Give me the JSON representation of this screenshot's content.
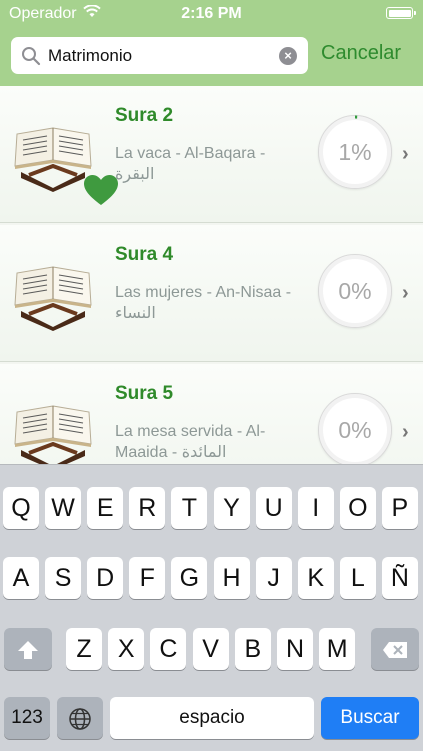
{
  "status_bar": {
    "carrier": "Operador",
    "time": "2:16 PM"
  },
  "search": {
    "value": "Matrimonio",
    "cancel_label": "Cancelar"
  },
  "results": [
    {
      "title": "Sura 2",
      "subtitle_line1": "La vaca - Al-Baqara -",
      "subtitle_line2": "البقرة",
      "progress": "1%",
      "progress_value": 1,
      "favorite": true
    },
    {
      "title": "Sura 4",
      "subtitle_line1": "Las mujeres - An-Nisaa -",
      "subtitle_line2": "النساء",
      "progress": "0%",
      "progress_value": 0,
      "favorite": false
    },
    {
      "title": "Sura 5",
      "subtitle_line1": "La mesa servida - Al-",
      "subtitle_line2": "Maaida - المائدة",
      "progress": "0%",
      "progress_value": 0,
      "favorite": false
    }
  ],
  "keyboard": {
    "row1": [
      "Q",
      "W",
      "E",
      "R",
      "T",
      "Y",
      "U",
      "I",
      "O",
      "P"
    ],
    "row2": [
      "A",
      "S",
      "D",
      "F",
      "G",
      "H",
      "J",
      "K",
      "L",
      "Ñ"
    ],
    "row3": [
      "Z",
      "X",
      "C",
      "V",
      "B",
      "N",
      "M"
    ],
    "numbers_label": "123",
    "space_label": "espacio",
    "search_label": "Buscar"
  },
  "colors": {
    "bar_green": "#a6d28e",
    "title_green": "#2f8a2a",
    "favorite_green": "#3f9a3f",
    "search_key_blue": "#1f7ef5"
  },
  "icons": [
    "wifi-icon",
    "battery-icon",
    "search-icon",
    "clear-icon",
    "quran-book-icon",
    "heart-icon",
    "chevron-right-icon",
    "shift-icon",
    "backspace-icon",
    "globe-icon"
  ]
}
